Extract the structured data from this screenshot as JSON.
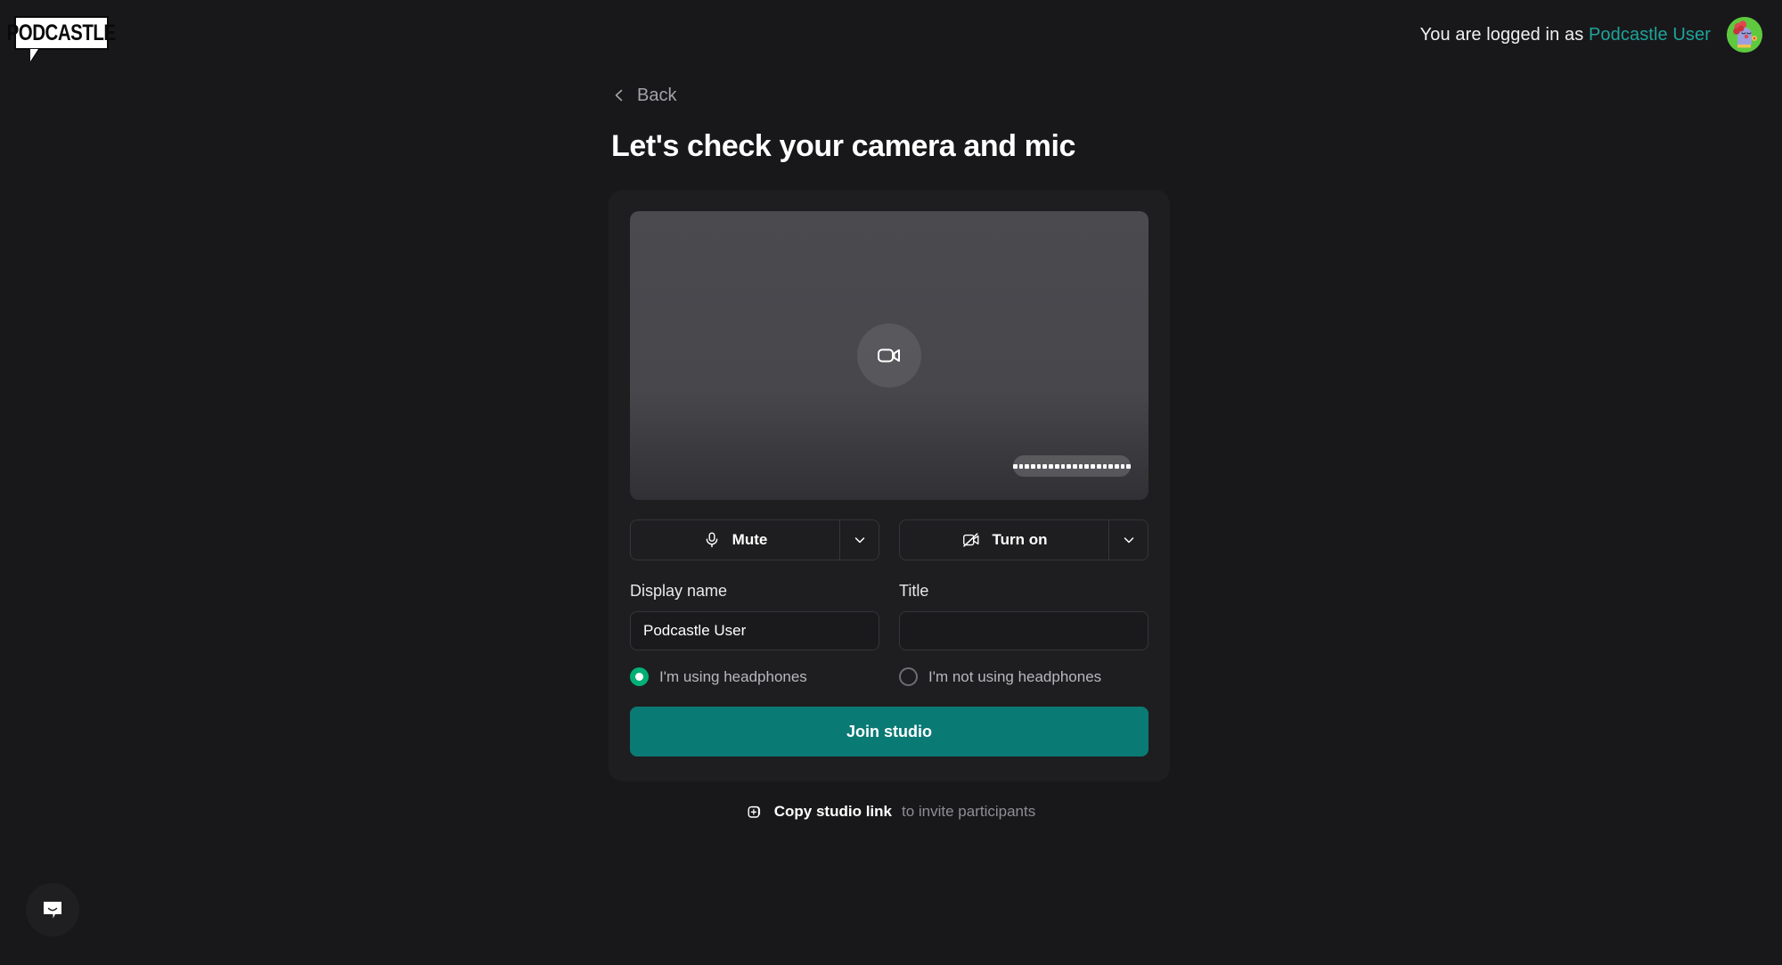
{
  "header": {
    "logo_text": "PODCASTLE",
    "logged_in_prefix": "You are logged in as",
    "user_name": "Podcastle User",
    "avatar_icon": "user-avatar-illustration",
    "user_link_color": "#1fa39b"
  },
  "nav": {
    "back_label": "Back",
    "back_icon": "chevron-left-icon"
  },
  "page": {
    "title": "Let's check your camera and mic"
  },
  "preview": {
    "camera_placeholder_icon": "video-camera-icon",
    "audio_meter_segments": 20,
    "audio_meter_icon": "audio-level-meter"
  },
  "devices": {
    "mic": {
      "label": "Mute",
      "icon": "microphone-icon",
      "caret_icon": "chevron-down-icon"
    },
    "camera": {
      "label": "Turn on",
      "icon": "video-camera-off-icon",
      "caret_icon": "chevron-down-icon"
    }
  },
  "fields": {
    "display_name": {
      "label": "Display name",
      "value": "Podcastle User",
      "placeholder": ""
    },
    "title": {
      "label": "Title",
      "value": "",
      "placeholder": ""
    }
  },
  "headphones": {
    "using": {
      "label": "I'm using headphones",
      "selected": true,
      "color": "#00b074"
    },
    "not_using": {
      "label": "I'm not using headphones",
      "selected": false
    }
  },
  "actions": {
    "join_label": "Join studio",
    "join_color": "#0a7a75",
    "copy_link_label": "Copy studio link",
    "copy_link_suffix": "to invite participants",
    "copy_icon": "copy-add-icon"
  },
  "support": {
    "chat_icon": "intercom-chat-bubble-icon"
  }
}
